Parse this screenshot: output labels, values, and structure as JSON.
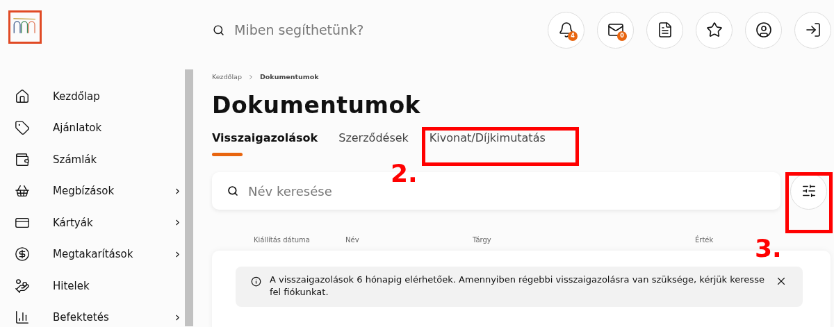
{
  "header": {
    "search": {
      "placeholder": "Miben segíthetünk?"
    },
    "actions": [
      {
        "kind": "bell",
        "badge": "4"
      },
      {
        "kind": "mail",
        "badge": "0"
      },
      {
        "kind": "document"
      },
      {
        "kind": "star"
      },
      {
        "kind": "profile"
      },
      {
        "kind": "logout"
      }
    ]
  },
  "sidebar": {
    "items": [
      {
        "label": "Kezdőlap",
        "kind": "home",
        "has_submenu": false
      },
      {
        "label": "Ajánlatok",
        "kind": "tag",
        "has_submenu": false
      },
      {
        "label": "Számlák",
        "kind": "wallet",
        "has_submenu": false
      },
      {
        "label": "Megbízások",
        "kind": "basket",
        "has_submenu": true
      },
      {
        "label": "Kártyák",
        "kind": "card",
        "has_submenu": true
      },
      {
        "label": "Megtakarítások",
        "kind": "moneybag",
        "has_submenu": true
      },
      {
        "label": "Hitelek",
        "kind": "hand",
        "has_submenu": false
      },
      {
        "label": "Befektetés",
        "kind": "chart",
        "has_submenu": true
      }
    ]
  },
  "breadcrumb": [
    "Kezdőlap",
    "Dokumentumok"
  ],
  "title": "Dokumentumok",
  "tabs": [
    {
      "label": "Visszaigazolások",
      "selected": true
    },
    {
      "label": "Szerződések",
      "selected": false
    },
    {
      "label": "Kivonat/Díjkimutatás",
      "selected": false
    }
  ],
  "name_search": {
    "placeholder": "Név keresése"
  },
  "table": {
    "columns": [
      "Kiállítás dátuma",
      "Név",
      "Tárgy",
      "Érték"
    ]
  },
  "notice": {
    "text": "A visszaigazolások 6 hónapig elérhetőek. Amennyiben régebbi visszaigazolásra van szüksége, kérjük keresse fel fiókunkat."
  },
  "annotations": [
    {
      "label": "2."
    },
    {
      "label": "3."
    }
  ]
}
